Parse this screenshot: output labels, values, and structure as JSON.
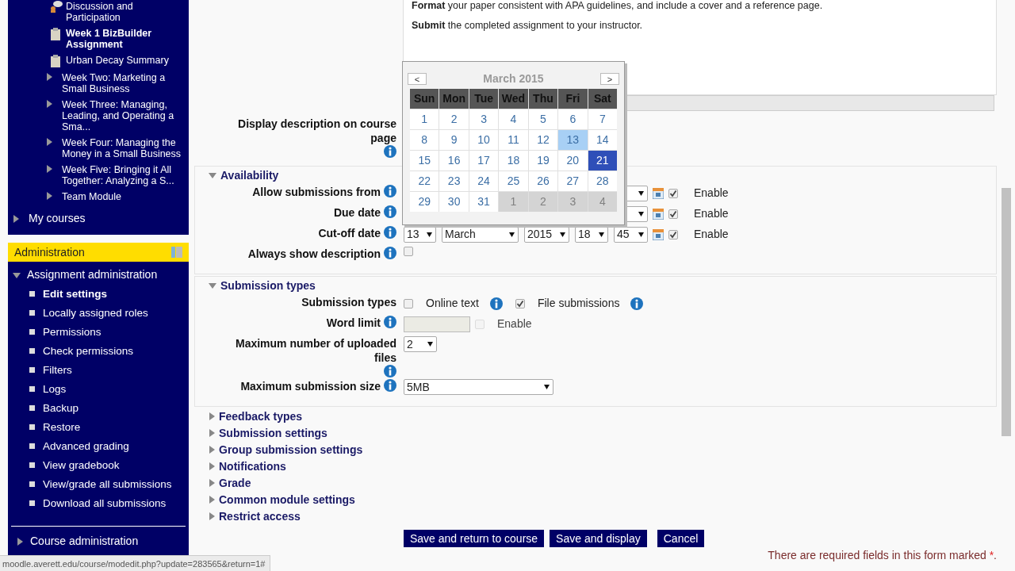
{
  "sidebar": {
    "course_items": [
      {
        "kind": "forum",
        "label": "Discussion and Participation",
        "current": false
      },
      {
        "kind": "assignment",
        "label": "Week 1 BizBuilder Assignment",
        "current": true
      },
      {
        "kind": "assignment",
        "label": "Urban Decay Summary",
        "current": false
      },
      {
        "kind": "section",
        "label": "Week Two: Marketing a Small Business"
      },
      {
        "kind": "section",
        "label": "Week Three: Managing, Leading, and Operating a Sma..."
      },
      {
        "kind": "section",
        "label": "Week Four: Managing the Money in a Small Business"
      },
      {
        "kind": "section",
        "label": "Week Five: Bringing it All Together: Analyzing a S..."
      },
      {
        "kind": "section",
        "label": "Team Module"
      }
    ],
    "my_courses": {
      "label": "My courses",
      "expanded": false
    },
    "administration": {
      "title": "Administration",
      "nodes": [
        {
          "label": "Assignment administration",
          "expanded": true,
          "children": [
            {
              "label": "Edit settings",
              "current": true
            },
            {
              "label": "Locally assigned roles",
              "current": false
            },
            {
              "label": "Permissions",
              "current": false
            },
            {
              "label": "Check permissions",
              "current": false
            },
            {
              "label": "Filters",
              "current": false
            },
            {
              "label": "Logs",
              "current": false
            },
            {
              "label": "Backup",
              "current": false
            },
            {
              "label": "Restore",
              "current": false
            },
            {
              "label": "Advanced grading",
              "current": false
            },
            {
              "label": "View gradebook",
              "current": false
            },
            {
              "label": "View/grade all submissions",
              "current": false
            },
            {
              "label": "Download all submissions",
              "current": false
            }
          ]
        },
        {
          "label": "Course administration",
          "expanded": false
        }
      ]
    }
  },
  "description": [
    "**Format** your paper consistent with APA guidelines, and include a cover and a reference page.",
    "**Submit** the completed assignment to your instructor."
  ],
  "display_description_label": "Display description on course page",
  "sections": [
    {
      "title": "Availability",
      "expanded": true,
      "fields": [
        {
          "kind": "date",
          "label": "Allow submissions from",
          "enabled": true,
          "enable_label": "Enable"
        },
        {
          "kind": "date",
          "label": "Due date",
          "enabled": true,
          "enable_label": "Enable"
        },
        {
          "kind": "date",
          "label": "Cut-off date",
          "values": [
            "13",
            "March",
            "2015",
            "18",
            "45"
          ],
          "enabled": true,
          "enable_label": "Enable"
        },
        {
          "kind": "checkbox",
          "label": "Always show description",
          "checked": false
        }
      ]
    },
    {
      "title": "Submission types",
      "expanded": true,
      "fields": [
        {
          "kind": "options",
          "label": "Submission types",
          "options": [
            {
              "label": "Online text",
              "checked": false
            },
            {
              "label": "File submissions",
              "checked": true
            }
          ]
        },
        {
          "kind": "number",
          "label": "Word limit",
          "enabled": false,
          "enable_label": "Enable"
        },
        {
          "kind": "short_select",
          "label": "Maximum number of uploaded files",
          "value": "2"
        },
        {
          "kind": "select",
          "label": "Maximum submission size",
          "value": "5MB"
        }
      ]
    },
    {
      "title": "Feedback types",
      "expanded": false
    },
    {
      "title": "Submission settings",
      "expanded": false
    },
    {
      "title": "Group submission settings",
      "expanded": false
    },
    {
      "title": "Notifications",
      "expanded": false
    },
    {
      "title": "Grade",
      "expanded": false
    },
    {
      "title": "Common module settings",
      "expanded": false
    },
    {
      "title": "Restrict access",
      "expanded": false
    }
  ],
  "buttons": [
    "Save and return to course",
    "Save and display",
    "Cancel"
  ],
  "required_note": {
    "text": "There are required fields in this form marked",
    "marker": "*",
    "end": "."
  },
  "calendar": {
    "title": "March 2015",
    "prev": "<",
    "next": ">",
    "weekdays": [
      "Sun",
      "Mon",
      "Tue",
      "Wed",
      "Thu",
      "Fri",
      "Sat"
    ],
    "days": [
      {
        "label": "1",
        "kind": "current",
        "highlighted": false,
        "selected": false
      },
      {
        "label": "2",
        "kind": "current",
        "highlighted": false,
        "selected": false
      },
      {
        "label": "3",
        "kind": "current",
        "highlighted": false,
        "selected": false
      },
      {
        "label": "4",
        "kind": "current",
        "highlighted": false,
        "selected": false
      },
      {
        "label": "5",
        "kind": "current",
        "highlighted": false,
        "selected": false
      },
      {
        "label": "6",
        "kind": "current",
        "highlighted": false,
        "selected": false
      },
      {
        "label": "7",
        "kind": "current",
        "highlighted": false,
        "selected": false
      },
      {
        "label": "8",
        "kind": "current",
        "highlighted": false,
        "selected": false
      },
      {
        "label": "9",
        "kind": "current",
        "highlighted": false,
        "selected": false
      },
      {
        "label": "10",
        "kind": "current",
        "highlighted": false,
        "selected": false
      },
      {
        "label": "11",
        "kind": "current",
        "highlighted": false,
        "selected": false
      },
      {
        "label": "12",
        "kind": "current",
        "highlighted": false,
        "selected": false
      },
      {
        "label": "13",
        "kind": "current",
        "highlighted": true,
        "selected": false
      },
      {
        "label": "14",
        "kind": "current",
        "highlighted": false,
        "selected": false
      },
      {
        "label": "15",
        "kind": "current",
        "highlighted": false,
        "selected": false
      },
      {
        "label": "16",
        "kind": "current",
        "highlighted": false,
        "selected": false
      },
      {
        "label": "17",
        "kind": "current",
        "highlighted": false,
        "selected": false
      },
      {
        "label": "18",
        "kind": "current",
        "highlighted": false,
        "selected": false
      },
      {
        "label": "19",
        "kind": "current",
        "highlighted": false,
        "selected": false
      },
      {
        "label": "20",
        "kind": "current",
        "highlighted": false,
        "selected": false
      },
      {
        "label": "21",
        "kind": "current",
        "highlighted": false,
        "selected": true
      },
      {
        "label": "22",
        "kind": "current",
        "highlighted": false,
        "selected": false
      },
      {
        "label": "23",
        "kind": "current",
        "highlighted": false,
        "selected": false
      },
      {
        "label": "24",
        "kind": "current",
        "highlighted": false,
        "selected": false
      },
      {
        "label": "25",
        "kind": "current",
        "highlighted": false,
        "selected": false
      },
      {
        "label": "26",
        "kind": "current",
        "highlighted": false,
        "selected": false
      },
      {
        "label": "27",
        "kind": "current",
        "highlighted": false,
        "selected": false
      },
      {
        "label": "28",
        "kind": "current",
        "highlighted": false,
        "selected": false
      },
      {
        "label": "29",
        "kind": "current",
        "highlighted": false,
        "selected": false
      },
      {
        "label": "30",
        "kind": "current",
        "highlighted": false,
        "selected": false
      },
      {
        "label": "31",
        "kind": "current",
        "highlighted": false,
        "selected": false
      },
      {
        "label": "1",
        "kind": "other",
        "highlighted": false,
        "selected": false
      },
      {
        "label": "2",
        "kind": "other",
        "highlighted": false,
        "selected": false
      },
      {
        "label": "3",
        "kind": "other",
        "highlighted": false,
        "selected": false
      },
      {
        "label": "4",
        "kind": "other",
        "highlighted": false,
        "selected": false
      }
    ]
  },
  "status_bar": "moodle.averett.edu/course/modedit.php?update=283565&return=1#"
}
